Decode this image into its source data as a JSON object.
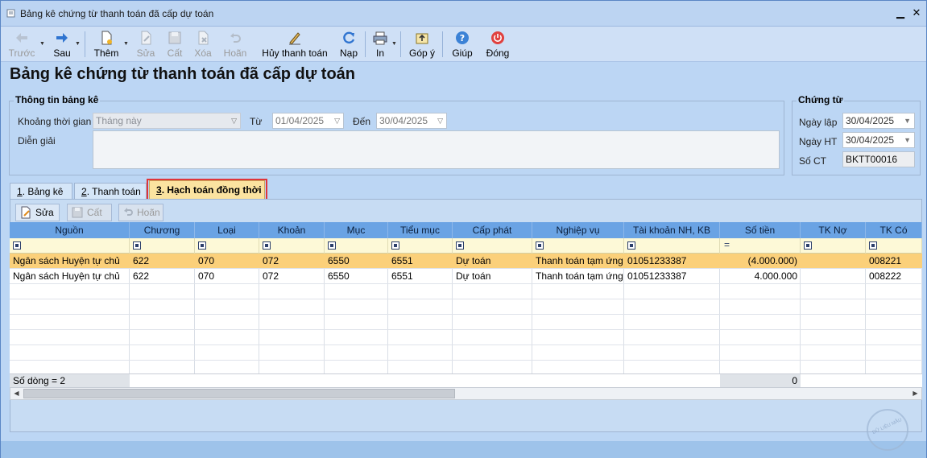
{
  "window": {
    "title": "Bảng kê chứng từ thanh toán đã cấp dự toán"
  },
  "toolbar": {
    "prev": "Trước",
    "next": "Sau",
    "add": "Thêm",
    "edit": "Sửa",
    "save": "Cất",
    "delete": "Xóa",
    "undo": "Hoãn",
    "cancel_payment": "Hủy thanh toán",
    "reload": "Nạp",
    "print": "In",
    "feedback": "Góp ý",
    "help": "Giúp",
    "close": "Đóng"
  },
  "page_title": "Bảng kê chứng từ thanh toán đã cấp dự toán",
  "info_group": {
    "title": "Thông tin bảng kê",
    "period_label": "Khoảng thời gian",
    "period_value": "Tháng này",
    "from_label": "Từ",
    "from_value": "01/04/2025",
    "to_label": "Đến",
    "to_value": "30/04/2025",
    "desc_label": "Diễn giải",
    "desc_value": ""
  },
  "voucher_group": {
    "title": "Chứng từ",
    "date_created_label": "Ngày lập",
    "date_created_value": "30/04/2025",
    "date_posted_label": "Ngày HT",
    "date_posted_value": "30/04/2025",
    "number_label": "Số CT",
    "number_value": "BKTT00016"
  },
  "tabs": [
    {
      "num": "1",
      "label": ". Bảng kê"
    },
    {
      "num": "2",
      "label": ". Thanh toán"
    },
    {
      "num": "3",
      "label": ". Hạch toán đồng thời"
    }
  ],
  "sub_toolbar": {
    "edit": "Sửa",
    "save": "Cất",
    "undo": "Hoãn"
  },
  "grid": {
    "columns": [
      "Nguồn",
      "Chương",
      "Loại",
      "Khoản",
      "Mục",
      "Tiểu mục",
      "Cấp phát",
      "Nghiệp vụ",
      "Tài khoản NH, KB",
      "Số tiền",
      "TK Nợ",
      "TK Có"
    ],
    "filter_eq": "=",
    "rows": [
      [
        "Ngân sách Huyện tự chủ",
        "622",
        "070",
        "072",
        "6550",
        "6551",
        "Dự toán",
        "Thanh toán tạm ứng",
        "01051233387",
        "(4.000.000)",
        "",
        "008221"
      ],
      [
        "Ngân sách Huyện tự chủ",
        "622",
        "070",
        "072",
        "6550",
        "6551",
        "Dự toán",
        "Thanh toán tạm ứng",
        "01051233387",
        "4.000.000",
        "",
        "008222"
      ]
    ],
    "footer_count": "Số dòng = 2",
    "footer_total": "0"
  },
  "watermark": "DỮ LIỆU MẪU",
  "colors": {
    "header": "#6aa3e4",
    "selected_row": "#fbd07a",
    "active_tab": "#fbe3a0",
    "highlight": "#e0353a"
  }
}
